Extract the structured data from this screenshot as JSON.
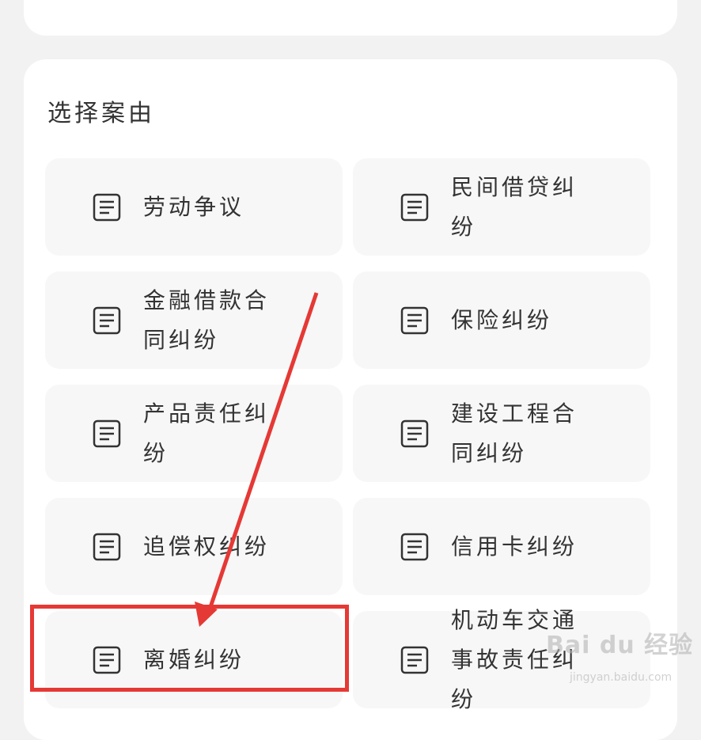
{
  "section": {
    "title": "选择案由"
  },
  "cases": [
    {
      "label": "劳动争议",
      "icon": "document-icon"
    },
    {
      "label": "民间借贷纠纷",
      "icon": "document-icon"
    },
    {
      "label": "金融借款合同纠纷",
      "icon": "document-icon"
    },
    {
      "label": "保险纠纷",
      "icon": "document-icon"
    },
    {
      "label": "产品责任纠纷",
      "icon": "document-icon"
    },
    {
      "label": "建设工程合同纠纷",
      "icon": "document-icon"
    },
    {
      "label": "追偿权纠纷",
      "icon": "document-icon"
    },
    {
      "label": "信用卡纠纷",
      "icon": "document-icon"
    },
    {
      "label": "离婚纠纷",
      "icon": "document-icon"
    },
    {
      "label": "机动车交通事故责任纠纷",
      "icon": "document-icon"
    }
  ],
  "annotation": {
    "highlight_color": "#e53935",
    "highlighted_item": "离婚纠纷"
  },
  "watermark": {
    "text": "Bai du 经验",
    "sub": "jingyan.baidu.com"
  }
}
